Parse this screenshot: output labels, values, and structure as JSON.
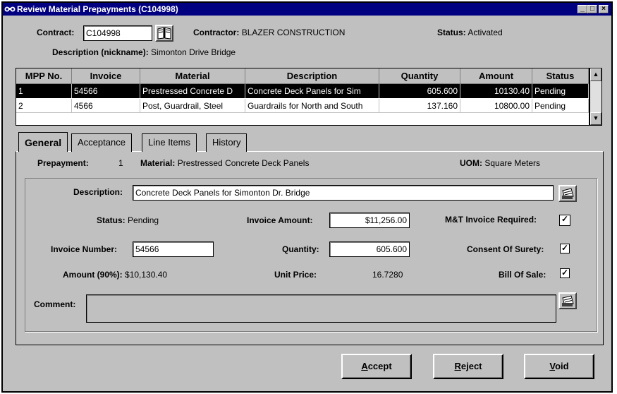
{
  "window": {
    "title": "Review Material Prepayments (C104998)",
    "min_glyph": "_",
    "max_glyph": "□",
    "close_glyph": "×"
  },
  "header": {
    "contract_label": "Contract:",
    "contract_value": "C104998",
    "contractor_label": "Contractor:",
    "contractor_value": "BLAZER CONSTRUCTION",
    "status_label": "Status:",
    "status_value": "Activated",
    "description_label": "Description (nickname):",
    "description_value": "Simonton Drive Bridge"
  },
  "grid": {
    "columns": [
      "MPP No.",
      "Invoice",
      "Material",
      "Description",
      "Quantity",
      "Amount",
      "Status"
    ],
    "rows": [
      {
        "mpp": "1",
        "invoice": "54566",
        "material": "Prestressed Concrete D",
        "description": "Concrete Deck Panels for Sim",
        "quantity": "605.600",
        "amount": "10130.40",
        "status": "Pending"
      },
      {
        "mpp": "2",
        "invoice": "4566",
        "material": "Post, Guardrail, Steel",
        "description": "Guardrails for North and South",
        "quantity": "137.160",
        "amount": "10800.00",
        "status": "Pending"
      }
    ]
  },
  "tabs": [
    {
      "label": "General"
    },
    {
      "label": "Acceptance"
    },
    {
      "label": "Line Items"
    },
    {
      "label": "History"
    }
  ],
  "general": {
    "prepayment_label": "Prepayment:",
    "prepayment_value": "1",
    "material_label": "Material:",
    "material_value": "Prestressed Concrete Deck Panels",
    "uom_label": "UOM:",
    "uom_value": "Square Meters",
    "description_label": "Description:",
    "description_value": "Concrete Deck Panels for Simonton Dr. Bridge",
    "status_label": "Status:",
    "status_value": "Pending",
    "invoice_amount_label": "Invoice Amount:",
    "invoice_amount_value": "$11,256.00",
    "mt_invoice_label": "M&T Invoice Required:",
    "mt_invoice_checked": true,
    "invoice_number_label": "Invoice Number:",
    "invoice_number_value": "54566",
    "quantity_label": "Quantity:",
    "quantity_value": "605.600",
    "consent_label": "Consent Of Surety:",
    "consent_checked": true,
    "amount90_label": "Amount (90%):",
    "amount90_value": "$10,130.40",
    "unit_price_label": "Unit Price:",
    "unit_price_value": "16.7280",
    "bill_of_sale_label": "Bill Of Sale:",
    "bill_of_sale_checked": true,
    "comment_label": "Comment:",
    "comment_value": ""
  },
  "buttons": {
    "accept_mnemonic": "A",
    "accept_rest": "ccept",
    "reject_mnemonic": "R",
    "reject_rest": "eject",
    "void_mnemonic": "V",
    "void_rest": "oid"
  },
  "colors": {
    "titlebar": "#000080",
    "face": "#c0c0c0",
    "selected_row": "#000000"
  },
  "icons": {
    "app": "binoculars-icon",
    "contract_lookup": "book-icon",
    "description_edit": "notepad-icon",
    "comment_edit": "notepad-icon"
  }
}
